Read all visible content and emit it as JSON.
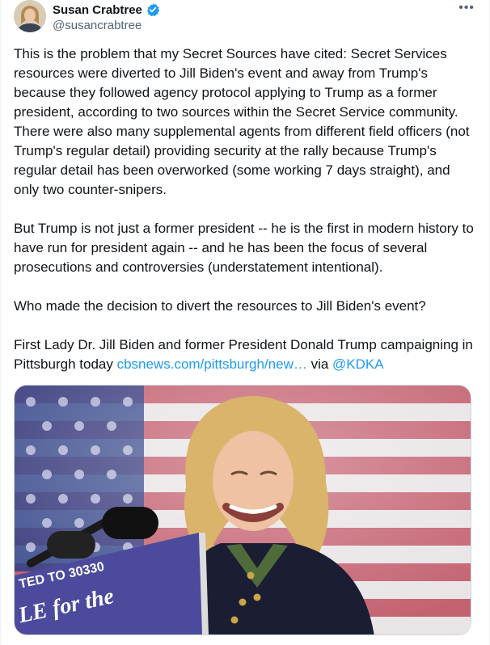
{
  "author": {
    "display_name": "Susan Crabtree",
    "handle": "@susancrabtree",
    "more_label": "•••"
  },
  "tweet": {
    "p1": "This is the problem that my Secret Sources have cited: Secret Services resources were diverted to Jill Biden's event and away from Trump's because they followed agency protocol applying to Trump as a former president, according to two sources within the Secret Service community. There were also many supplemental agents from different field officers (not Trump's regular detail) providing security at the rally because Trump's regular detail has been overworked (some working 7 days straight), and only two counter-snipers.",
    "p2": "But Trump is not just a former president -- he is the first in modern history to have run for president again -- and he has been the focus of several prosecutions and controversies (understatement intentional).",
    "p3": "Who made the decision to divert the resources to Jill Biden's event?",
    "p4_text": "First Lady Dr. Jill Biden and former President Donald Trump campaigning in Pittsburgh today ",
    "p4_link": "cbsnews.com/pittsburgh/new…",
    "p4_via": " via ",
    "p4_mention": "@KDKA"
  },
  "media": {
    "podium_line1": "TED TO 30330",
    "podium_line2": "LE for the"
  },
  "colors": {
    "link": "#1d9bf0",
    "verified": "#1d9bf0",
    "podium": "#4b4a9c",
    "flag_red": "#b7374a",
    "flag_blue": "#2c3f86"
  },
  "icons": {
    "verified": "verified-badge-icon",
    "more": "more-options-icon"
  }
}
